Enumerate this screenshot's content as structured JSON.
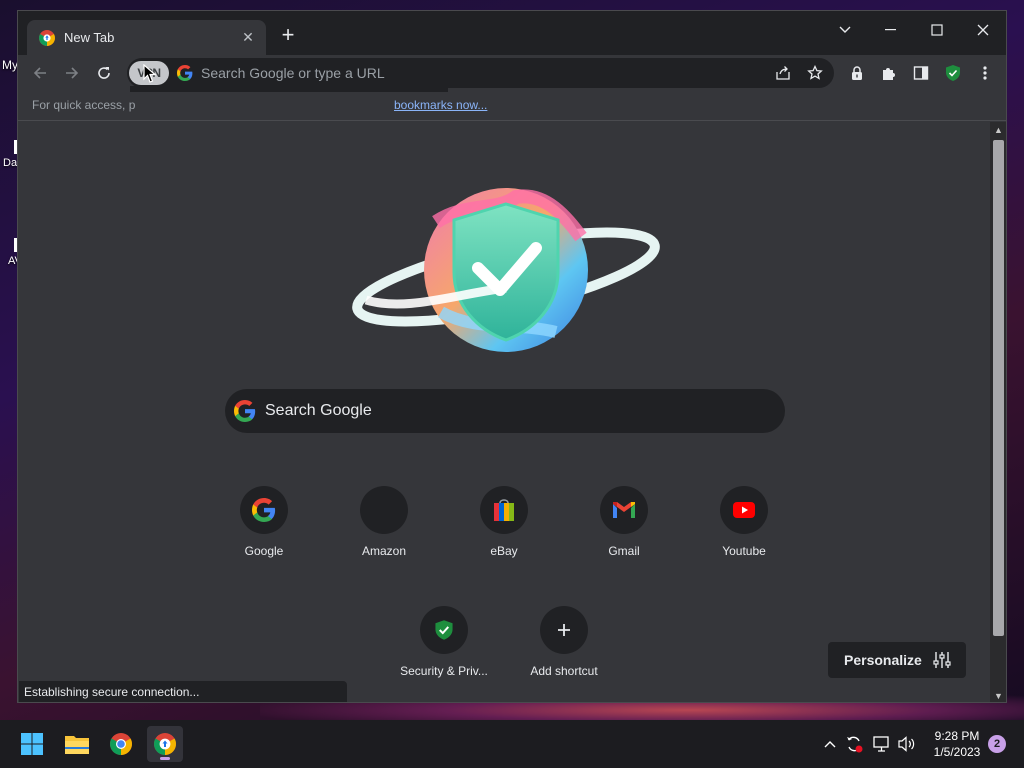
{
  "desktop": {
    "labels": [
      "My",
      "Da",
      "AV"
    ]
  },
  "browser": {
    "tab": {
      "title": "New Tab"
    },
    "omnibox": {
      "vpn_label": "VPN",
      "placeholder": "Search Google or type a URL"
    },
    "bookmarks_bar": {
      "hint_text": "For quick access, p",
      "import_link": "bookmarks now..."
    },
    "new_tab_page": {
      "search_placeholder": "Search Google",
      "shortcuts": [
        {
          "label": "Google",
          "icon": "google-icon"
        },
        {
          "label": "Amazon",
          "icon": "amazon-icon"
        },
        {
          "label": "eBay",
          "icon": "ebay-icon"
        },
        {
          "label": "Gmail",
          "icon": "gmail-icon"
        },
        {
          "label": "Youtube",
          "icon": "youtube-icon"
        },
        {
          "label": "Security & Priv...",
          "icon": "security-shield-icon"
        },
        {
          "label": "Add shortcut",
          "icon": "plus-icon"
        }
      ],
      "personalize_label": "Personalize"
    },
    "status_text": "Establishing secure connection..."
  },
  "taskbar": {
    "time": "9:28 PM",
    "date": "1/5/2023",
    "notification_count": "2"
  },
  "colors": {
    "window_bg": "#35363a",
    "titlebar_bg": "#202124",
    "link": "#8ab4f8",
    "shield_green": "#1e8e3e"
  }
}
